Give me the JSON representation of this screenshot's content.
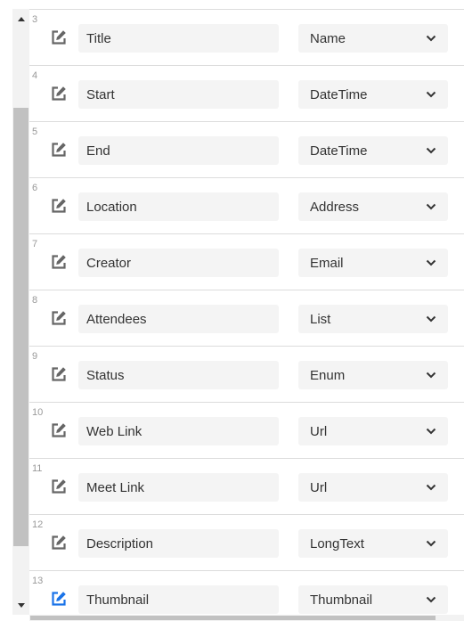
{
  "rows": [
    {
      "num": "3",
      "field": "Title",
      "type": "Name",
      "active": false
    },
    {
      "num": "4",
      "field": "Start",
      "type": "DateTime",
      "active": false
    },
    {
      "num": "5",
      "field": "End",
      "type": "DateTime",
      "active": false
    },
    {
      "num": "6",
      "field": "Location",
      "type": "Address",
      "active": false
    },
    {
      "num": "7",
      "field": "Creator",
      "type": "Email",
      "active": false
    },
    {
      "num": "8",
      "field": "Attendees",
      "type": "List",
      "active": false
    },
    {
      "num": "9",
      "field": "Status",
      "type": "Enum",
      "active": false
    },
    {
      "num": "10",
      "field": "Web Link",
      "type": "Url",
      "active": false
    },
    {
      "num": "11",
      "field": "Meet Link",
      "type": "Url",
      "active": false
    },
    {
      "num": "12",
      "field": "Description",
      "type": "LongText",
      "active": false
    },
    {
      "num": "13",
      "field": "Thumbnail",
      "type": "Thumbnail",
      "active": true
    }
  ],
  "icons": {
    "edit": "edit-icon",
    "dropdown": "chevron-down-icon"
  },
  "colors": {
    "icon_default": "#666666",
    "icon_active": "#1a73e8"
  }
}
